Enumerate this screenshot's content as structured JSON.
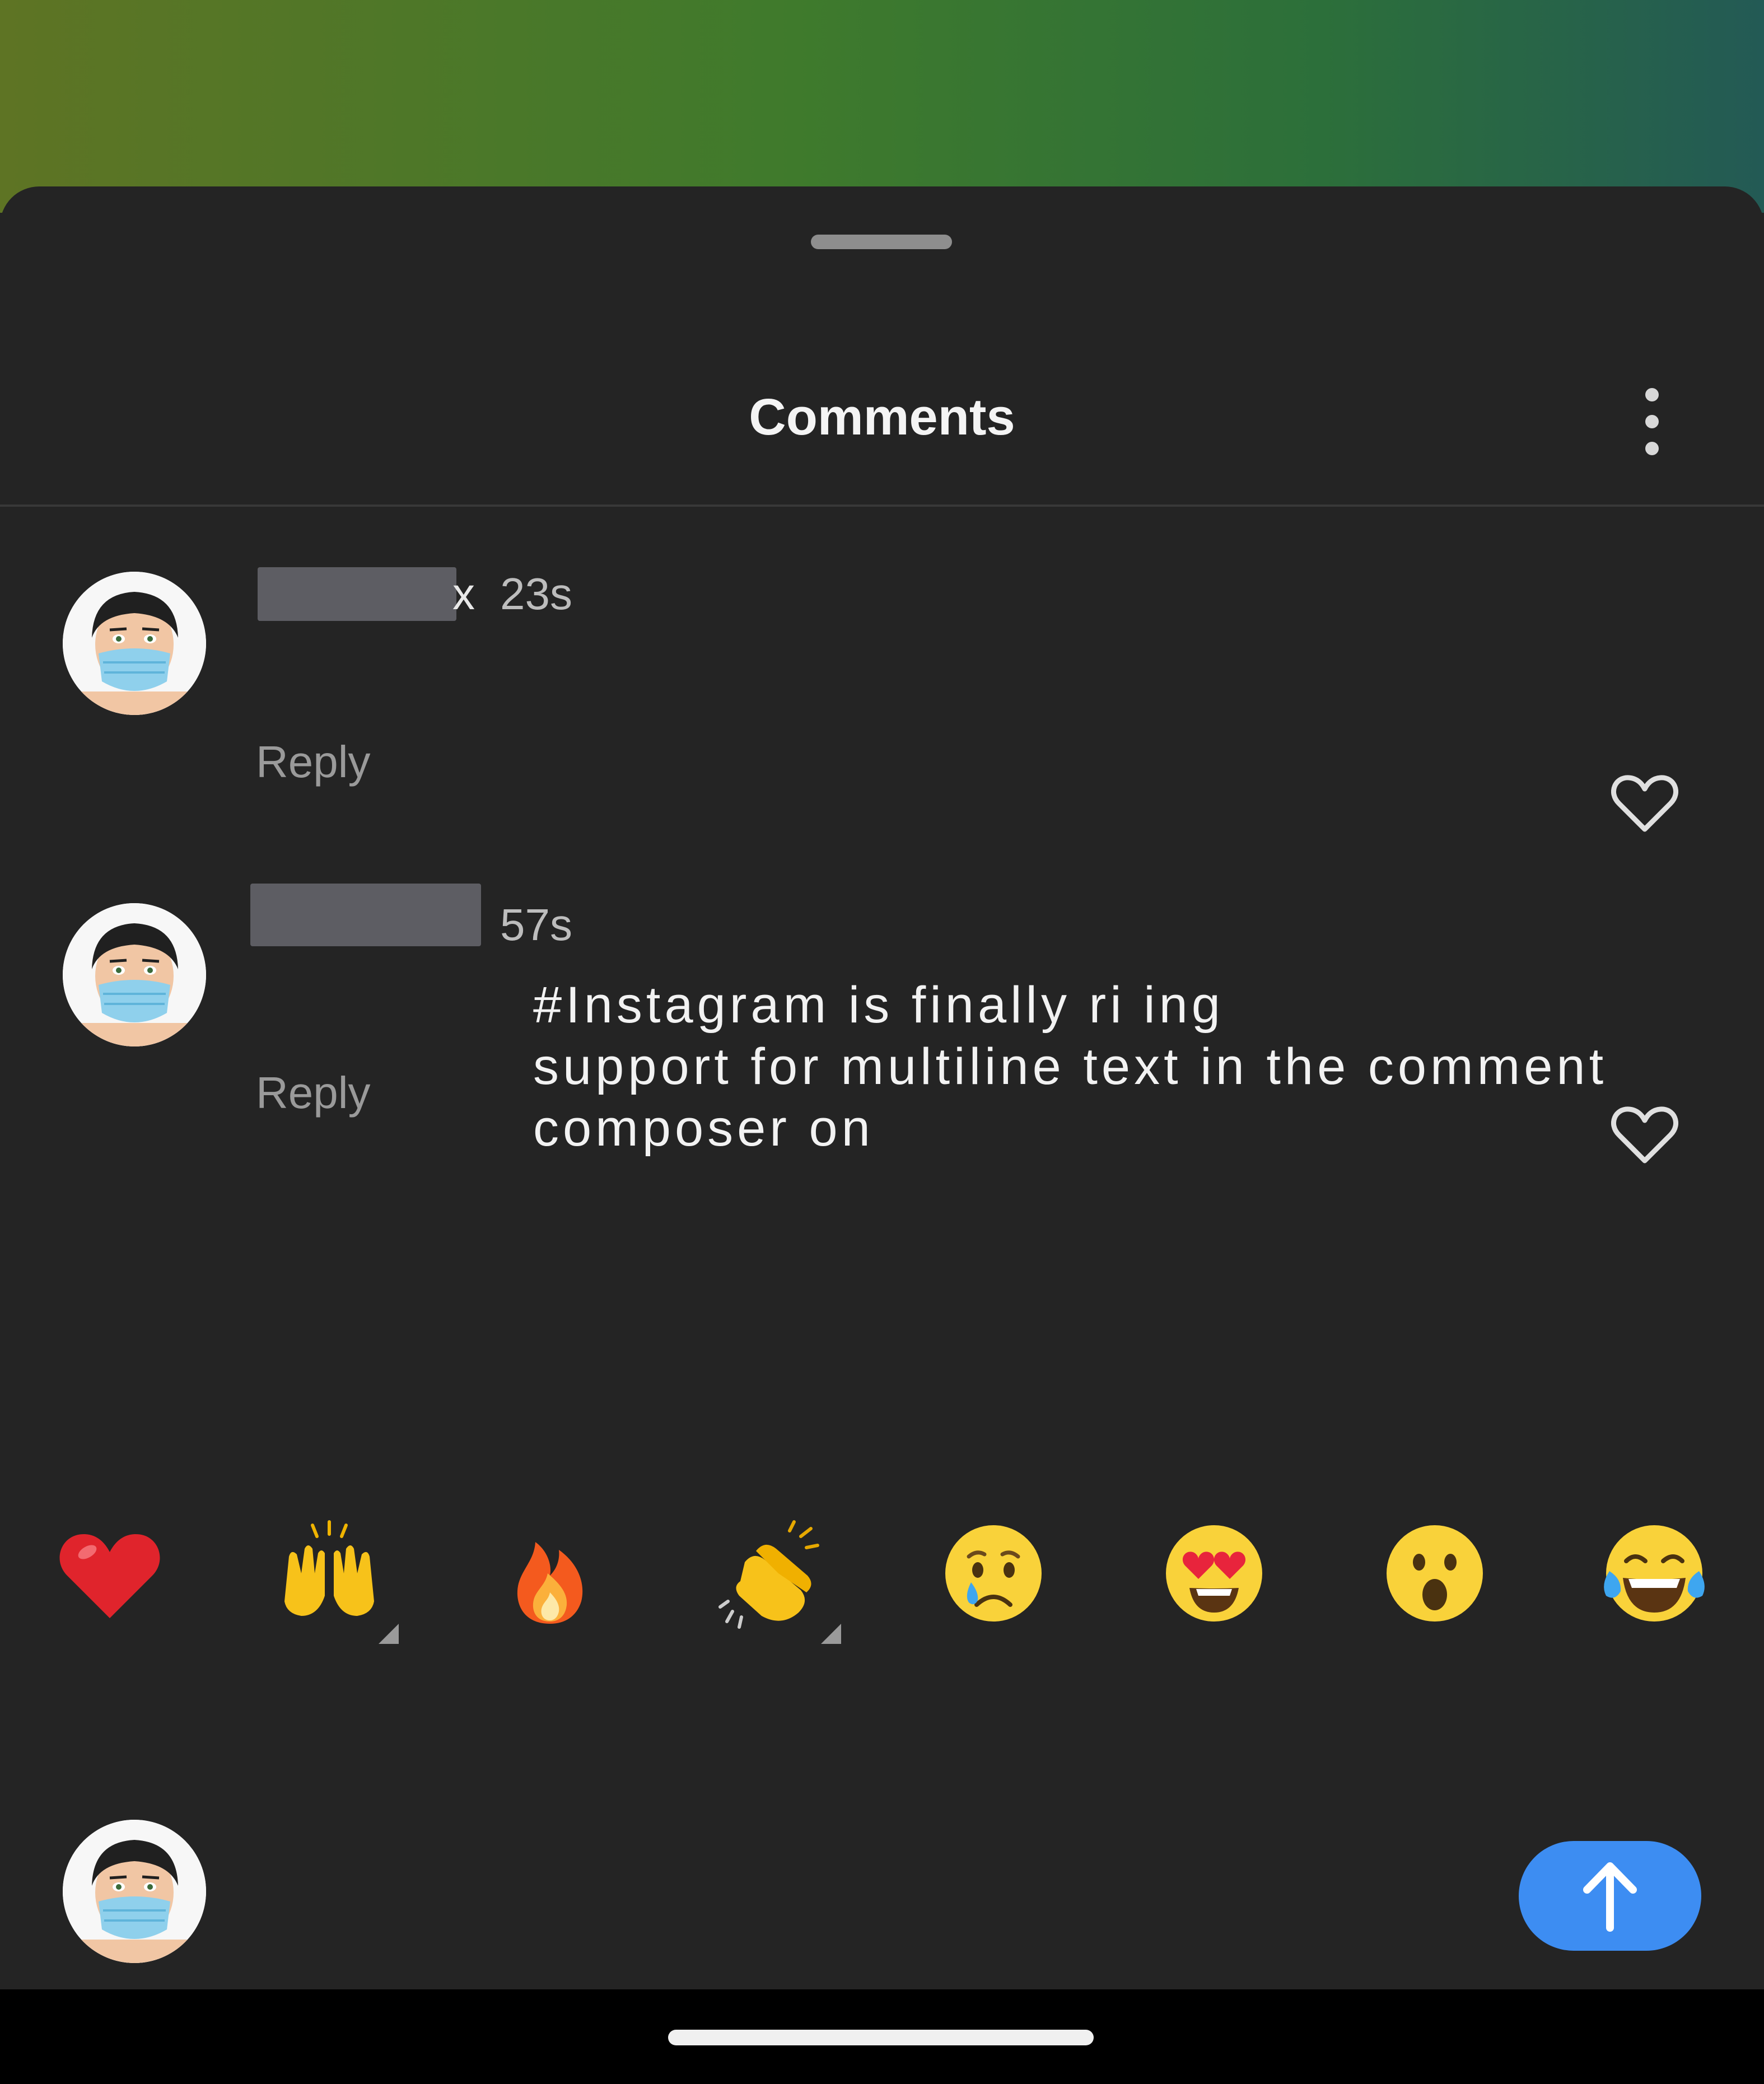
{
  "header": {
    "title": "Comments"
  },
  "comments": [
    {
      "username_tail": "x",
      "time": "23s",
      "text": "",
      "reply_label": "Reply"
    },
    {
      "username_tail": "",
      "time": "57s",
      "text_lines": [
        "#Instagram is finally ri  ing",
        "support for multiline text in the comment",
        "composer on"
      ],
      "reply_label": "Reply"
    }
  ],
  "emoji_bar": {
    "emojis": [
      "red-heart",
      "raising-hands",
      "fire",
      "clapping-hands",
      "crying-face",
      "heart-eyes",
      "surprised-face",
      "tears-of-joy"
    ]
  },
  "composer": {
    "send_icon": "arrow-up-icon"
  },
  "colors": {
    "background": "#242424",
    "accent": "#3d8df2",
    "muted_text": "#9a9a9a"
  }
}
